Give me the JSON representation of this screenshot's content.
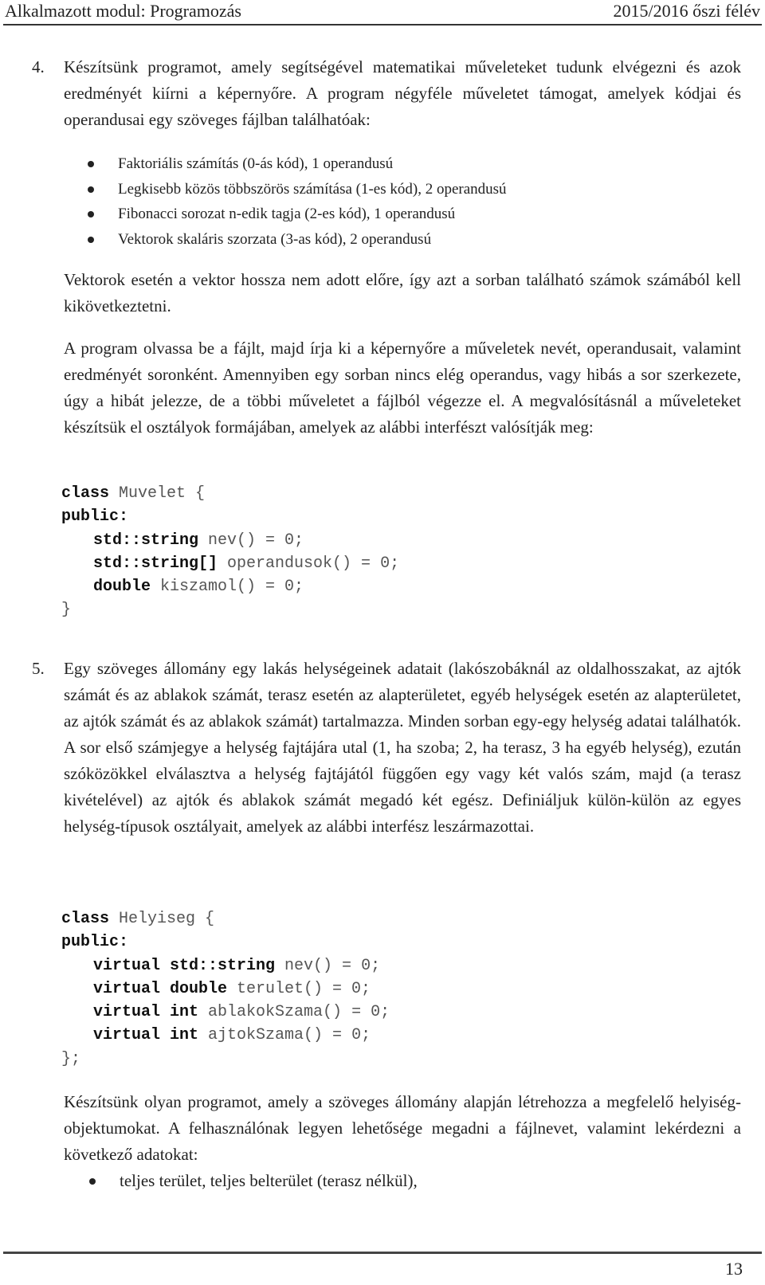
{
  "header": {
    "course": "Alkalmazott modul: Programozás",
    "semester": "2015/2016 őszi félév"
  },
  "task4": {
    "number": "4.",
    "intro": "Készítsünk programot, amely segítségével matematikai műveleteket tudunk elvégezni és azok eredményét kiírni a képernyőre. A program négyféle műveletet támogat, amelyek kódjai és operandusai egy szöveges fájlban találhatóak:",
    "operations": [
      "Faktoriális számítás (0-ás kód), 1 operandusú",
      "Legkisebb közös többszörös számítása (1-es kód), 2 operandusú",
      "Fibonacci sorozat n-edik tagja (2-es kód), 1 operandusú",
      "Vektorok skaláris szorzata (3-as kód), 2 operandusú"
    ],
    "vector_note": "Vektorok esetén a vektor hossza nem adott előre, így azt a sorban található számok számából kell kikövetkeztetni.",
    "program_desc": "A program olvassa be a fájlt, majd írja ki a képernyőre a műveletek nevét, operandusait, valamint eredményét soronként. Amennyiben egy sorban nincs elég operandus, vagy hibás a sor szerkezete, úgy a hibát jelezze, de a többi műveletet a fájlból végezze el. A megvalósításnál a műveleteket készítsük el osztályok formájában, amelyek az alábbi interfészt valósítják meg:",
    "code": {
      "kw_class": "class",
      "class_open": " Muvelet {",
      "kw_public": "public:",
      "lines": [
        {
          "kw": "std::string",
          "rest": " nev() = 0;"
        },
        {
          "kw": "std::string[]",
          "rest": " operandusok() = 0;"
        },
        {
          "kw": "double",
          "rest": " kiszamol() = 0;"
        }
      ],
      "close": "}"
    }
  },
  "task5": {
    "number": "5.",
    "intro": "Egy szöveges állomány egy lakás helységeinek adatait (lakószobáknál az oldalhosszakat, az ajtók számát és az ablakok számát, terasz esetén az alapterületet, egyéb helységek esetén az alapterületet, az ajtók számát és az ablakok számát) tartalmazza. Minden sorban egy-egy helység adatai találhatók. A sor első számjegye a helység fajtájára utal (1, ha szoba; 2, ha terasz, 3 ha egyéb helység), ezután szóközökkel elválasztva a helység fajtájától függően egy vagy két valós szám, majd (a terasz kivételével) az ajtók és ablakok számát megadó két egész. Definiáljuk külön-külön az egyes helység-típusok osztályait, amelyek az alábbi interfész leszármazottai.",
    "code": {
      "kw_class": "class",
      "class_open": " Helyiseg {",
      "kw_public": "public:",
      "lines": [
        {
          "kw": "virtual std::string",
          "rest": " nev() = 0;"
        },
        {
          "kw": "virtual double",
          "rest": " terulet() = 0;"
        },
        {
          "kw": "virtual int",
          "rest": " ablakokSzama() = 0;"
        },
        {
          "kw": "virtual int",
          "rest": " ajtokSzama() = 0;"
        }
      ],
      "close": "};"
    },
    "program_desc": "Készítsünk olyan programot, amely a szöveges állomány alapján létrehozza a megfelelő helyiség-objektumokat. A felhasználónak legyen lehetősége megadni a fájlnevet, valamint lekérdezni a következő adatokat:",
    "queries": [
      "teljes terület, teljes belterület (terasz nélkül),"
    ]
  },
  "footer": {
    "page_number": "13"
  }
}
